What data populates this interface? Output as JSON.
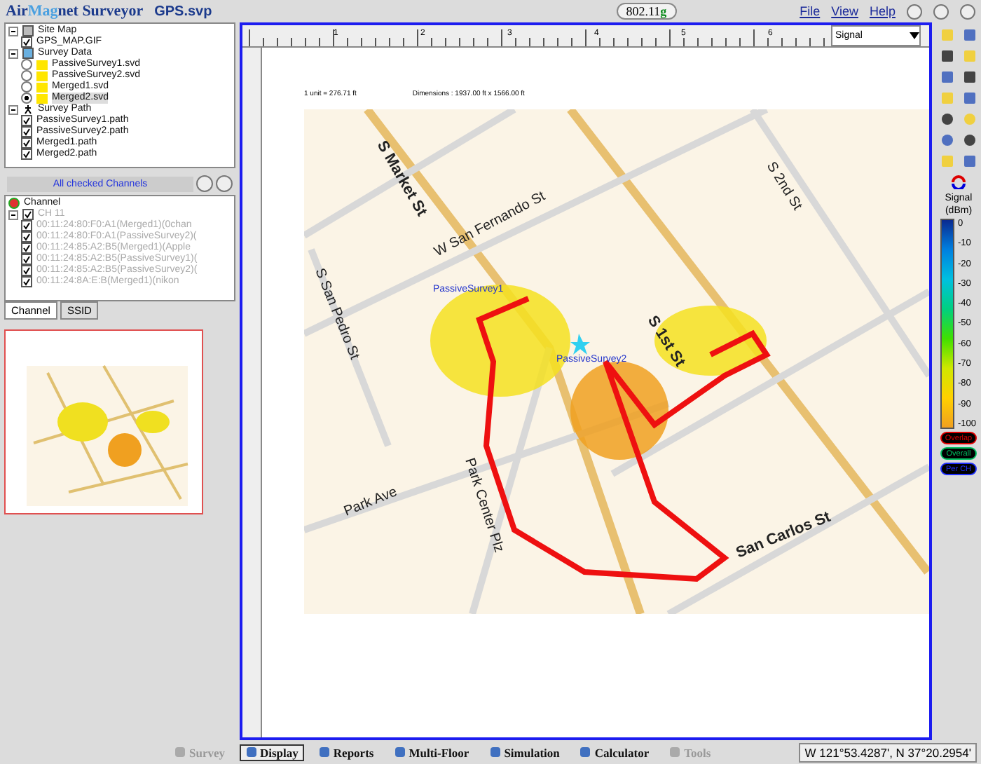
{
  "app": {
    "brand_left": "Air",
    "brand_mid": "Mag",
    "brand_right": "net Surveyor",
    "file": "GPS.svp",
    "band": "802.11",
    "band_suffix": "g"
  },
  "menu": [
    {
      "label": "File"
    },
    {
      "label": "View"
    },
    {
      "label": "Help"
    }
  ],
  "tree": [
    {
      "label": "Site Map",
      "expanded": true,
      "children": [
        {
          "label": "GPS_MAP.GIF",
          "kind": "check",
          "checked": true
        }
      ]
    },
    {
      "label": "Survey Data",
      "expanded": true,
      "children": [
        {
          "label": "PassiveSurvey1.svd",
          "kind": "radio",
          "selected": false
        },
        {
          "label": "PassiveSurvey2.svd",
          "kind": "radio",
          "selected": false
        },
        {
          "label": "Merged1.svd",
          "kind": "radio",
          "selected": false
        },
        {
          "label": "Merged2.svd",
          "kind": "radio",
          "selected": true
        }
      ]
    },
    {
      "label": "Survey Path",
      "expanded": true,
      "children": [
        {
          "label": "PassiveSurvey1.path",
          "kind": "check",
          "checked": true
        },
        {
          "label": "PassiveSurvey2.path",
          "kind": "check",
          "checked": true
        },
        {
          "label": "Merged1.path",
          "kind": "check",
          "checked": true
        },
        {
          "label": "Merged2.path",
          "kind": "check",
          "checked": true
        }
      ]
    }
  ],
  "channel_panel": {
    "header": "All checked Channels",
    "root": "Channel",
    "group": {
      "label": "CH 11",
      "checked": true,
      "expanded": true
    },
    "channels": [
      {
        "label": "00:11:24:80:F0:A1(Merged1)(0chan",
        "checked": true
      },
      {
        "label": "00:11:24:80:F0:A1(PassiveSurvey2)(",
        "checked": true
      },
      {
        "label": "00:11:24:85:A2:B5(Merged1)(Apple",
        "checked": true
      },
      {
        "label": "00:11:24:85:A2:B5(PassiveSurvey1)(",
        "checked": true
      },
      {
        "label": "00:11:24:85:A2:B5(PassiveSurvey2)(",
        "checked": true
      },
      {
        "label": "00:11:24:8A:E:B(Merged1)(nikon",
        "checked": true
      }
    ]
  },
  "panel_tabs": [
    {
      "label": "Channel",
      "selected": true
    },
    {
      "label": "SSID",
      "selected": false
    }
  ],
  "canvas": {
    "ruler_labels": [
      "1",
      "2",
      "3",
      "4",
      "5",
      "6"
    ],
    "view_select": "Signal",
    "scale": "1 unit = 276.71 ft",
    "dimensions": "Dimensions : 1937.00 ft x 1566.00 ft",
    "streets": [
      {
        "label": "S Market St"
      },
      {
        "label": "W San Fernando St"
      },
      {
        "label": "S San Pedro St"
      },
      {
        "label": "S 2nd St"
      },
      {
        "label": "S 1st St"
      },
      {
        "label": "Park Center Plz"
      },
      {
        "label": "Park Ave"
      },
      {
        "label": "San Carlos St"
      }
    ],
    "survey_labels": [
      {
        "label": "PassiveSurvey1"
      },
      {
        "label": "PassiveSurvey2"
      }
    ]
  },
  "legend": {
    "title": "Signal",
    "unit": "(dBm)",
    "ticks": [
      "0",
      "-10",
      "-20",
      "-30",
      "-40",
      "-50",
      "-60",
      "-70",
      "-80",
      "-90",
      "-100"
    ]
  },
  "modes": [
    {
      "label": "Overlap",
      "color": "#e00000"
    },
    {
      "label": "Overall",
      "color": "#00c060"
    },
    {
      "label": "Per CH",
      "color": "#2030ff"
    }
  ],
  "bottom_tabs": [
    {
      "label": "Survey",
      "selected": false,
      "disabled": true
    },
    {
      "label": "Display",
      "selected": true,
      "disabled": false
    },
    {
      "label": "Reports",
      "selected": false,
      "disabled": false
    },
    {
      "label": "Multi-Floor",
      "selected": false,
      "disabled": false
    },
    {
      "label": "Simulation",
      "selected": false,
      "disabled": false
    },
    {
      "label": "Calculator",
      "selected": false,
      "disabled": false
    },
    {
      "label": "Tools",
      "selected": false,
      "disabled": true
    }
  ],
  "status": "W 121°53.4287', N 37°20.2954'"
}
